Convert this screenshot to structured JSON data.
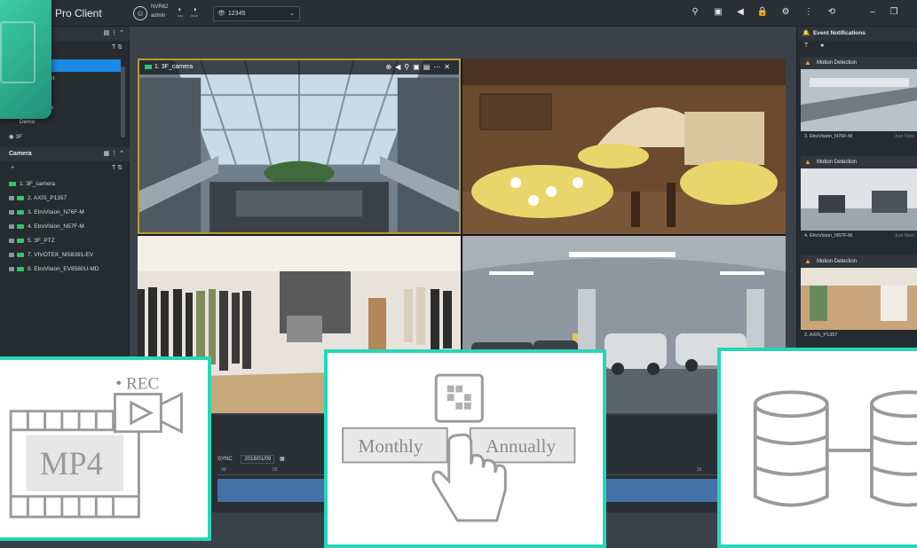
{
  "header": {
    "app_title": "Pro Client",
    "server": "NVR62",
    "user": "admin",
    "modes": [
      {
        "glyph": "◐",
        "label": "day"
      },
      {
        "glyph": "◑",
        "label": "dusk"
      }
    ],
    "view_value": "12345"
  },
  "left_panel": {
    "tree_items": [
      "et",
      "ew",
      "Demo",
      "3F"
    ],
    "camera_header": "Camera",
    "cameras": [
      "1. 3F_camera",
      "2. AXIS_P1357",
      "3. EtroVision_N76F-M",
      "4. EtroVision_N57F-M",
      "5. 3F_PTZ",
      "7. VIVOTEK_MS8391-EV",
      "8. EtroVision_EV8580U-MD"
    ]
  },
  "main": {
    "selected_camera_title": "1. 3F_camera"
  },
  "events": {
    "title": "Event Notifications",
    "items": [
      {
        "type": "Motion Detection",
        "camera": "3. EtroVision_N76F-M",
        "time": "Just Now"
      },
      {
        "type": "Motion Detection",
        "camera": "4. EtroVision_N57F-M",
        "time": "Just Now"
      },
      {
        "type": "Motion Detection",
        "camera": "2. AXIS_P1357",
        "time": ""
      }
    ]
  },
  "timeline": {
    "sync_label": "SYNC",
    "date": "2018/01/09",
    "ticks": [
      "00",
      "02",
      "04",
      "16",
      "18",
      "20"
    ]
  },
  "cards": {
    "mp4": {
      "rec_label": "• REC",
      "format_label": "MP4"
    },
    "schedule": {
      "option_1": "Monthly",
      "option_2": "Annually"
    }
  },
  "colors": {
    "accent": "#27d6b7",
    "selection": "#1e88e5",
    "live": "#35c46a",
    "warning": "#f5a623",
    "tile_highlight": "#b99a2d"
  }
}
